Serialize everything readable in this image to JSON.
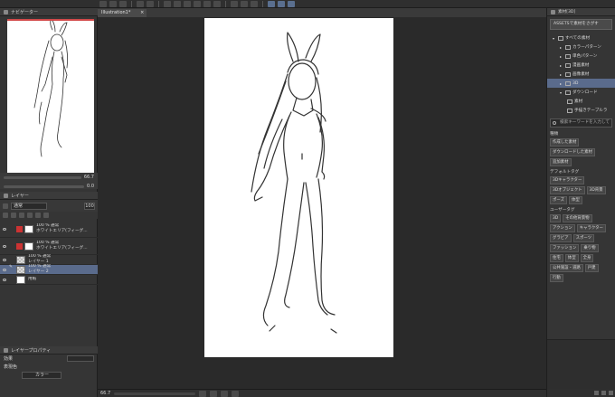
{
  "colors": {
    "accent": "#5a6b8c",
    "panel": "#353535",
    "canvas_bg": "#2a2a2a",
    "tab_red": "#d24a4a"
  },
  "navigator": {
    "title": "ナビゲーター",
    "zoom": "66.7",
    "angle": "0.0"
  },
  "layers": {
    "title": "レイヤー",
    "blend_mode": "通常",
    "opacity": "100",
    "items": [
      {
        "line1": "100 % 通常",
        "line2": "ホワイトエリア(フィーグ...",
        "thumb": "red"
      },
      {
        "line1": "100 % 通常",
        "line2": "ホワイトエリア(フィーグ...",
        "thumb": "red"
      },
      {
        "line1": "100 % 通常",
        "line2": "レイヤー 1",
        "thumb": "check"
      },
      {
        "line1": "100 % 通常",
        "line2": "レイヤー 2",
        "thumb": "check",
        "selected": true
      },
      {
        "line1": "",
        "line2": "用紙",
        "thumb": "white"
      }
    ]
  },
  "layer_props": {
    "title": "レイヤープロパティ",
    "effect_label": "効果",
    "color_label": "表現色",
    "color_value": "カラー"
  },
  "document": {
    "tab": "Illustration1*",
    "close": "×"
  },
  "status": {
    "zoom": "66.7"
  },
  "assets": {
    "title": "素材[3D]",
    "assets_button": "ASSETSで素材をさがす",
    "tree": [
      {
        "label": "すべての素材",
        "level": 0,
        "arrow": "▾"
      },
      {
        "label": "カラーパターン",
        "level": 1,
        "arrow": "▸"
      },
      {
        "label": "単色パターン",
        "level": 1,
        "arrow": "▸"
      },
      {
        "label": "漫画素材",
        "level": 1,
        "arrow": "▸"
      },
      {
        "label": "画像素材",
        "level": 1,
        "arrow": "▸"
      },
      {
        "label": "3D",
        "level": 1,
        "arrow": "▸",
        "selected": true
      },
      {
        "label": "ダウンロード",
        "level": 1,
        "arrow": "▾"
      },
      {
        "label": "素材",
        "level": 2,
        "arrow": ""
      },
      {
        "label": "手描きテーブルラ",
        "level": 2,
        "arrow": ""
      }
    ],
    "search_placeholder": "検索キーワードを入力して",
    "sections": [
      {
        "title": "種類",
        "tags": [
          "作成した素材",
          "ダウンロードした素材",
          "追加素材"
        ]
      },
      {
        "title": "デフォルトタグ",
        "tags": [
          "3Dキャラクター",
          "3Dオブジェクト",
          "3D背景",
          "ポーズ",
          "体型"
        ]
      },
      {
        "title": "ユーザータグ",
        "tags": [
          "3D",
          "その他背景物",
          "アクション",
          "キャラクター",
          "グラビア",
          "スポーツ",
          "ファッション",
          "乗り物",
          "住宅",
          "体型",
          "全身",
          "公共施設・道路",
          "戸建",
          "行動"
        ]
      }
    ]
  }
}
